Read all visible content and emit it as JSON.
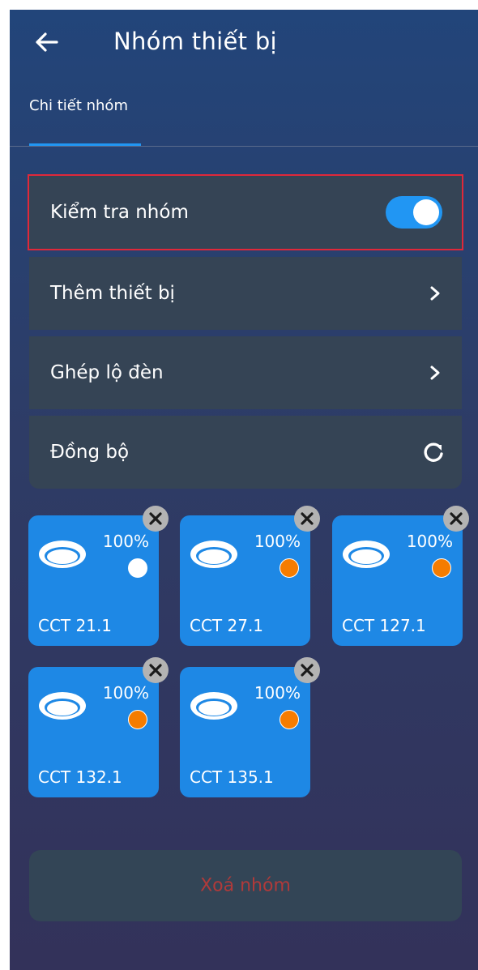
{
  "header": {
    "title": "Nhóm thiết bị"
  },
  "tabs": [
    {
      "label": "Chi tiết nhóm"
    }
  ],
  "menu": {
    "check_group": {
      "label": "Kiểm tra nhóm",
      "toggle_on": true
    },
    "add_device": {
      "label": "Thêm thiết bị"
    },
    "pair_lights": {
      "label": "Ghép lộ đèn"
    },
    "sync": {
      "label": "Đồng bộ"
    }
  },
  "devices": [
    {
      "name": "CCT 21.1",
      "level": "100%",
      "dot_color": "#ffffff"
    },
    {
      "name": "CCT 27.1",
      "level": "100%",
      "dot_color": "#f57c00"
    },
    {
      "name": "CCT 127.1",
      "level": "100%",
      "dot_color": "#f57c00"
    },
    {
      "name": "CCT 132.1",
      "level": "100%",
      "dot_color": "#f57c00"
    },
    {
      "name": "CCT 135.1",
      "level": "100%",
      "dot_color": "#f57c00"
    }
  ],
  "footer": {
    "delete_label": "Xoá nhóm"
  },
  "colors": {
    "accent": "#2196f3",
    "card": "#1e88e5",
    "danger": "#b03a3a",
    "highlight_border": "#e0283a"
  }
}
